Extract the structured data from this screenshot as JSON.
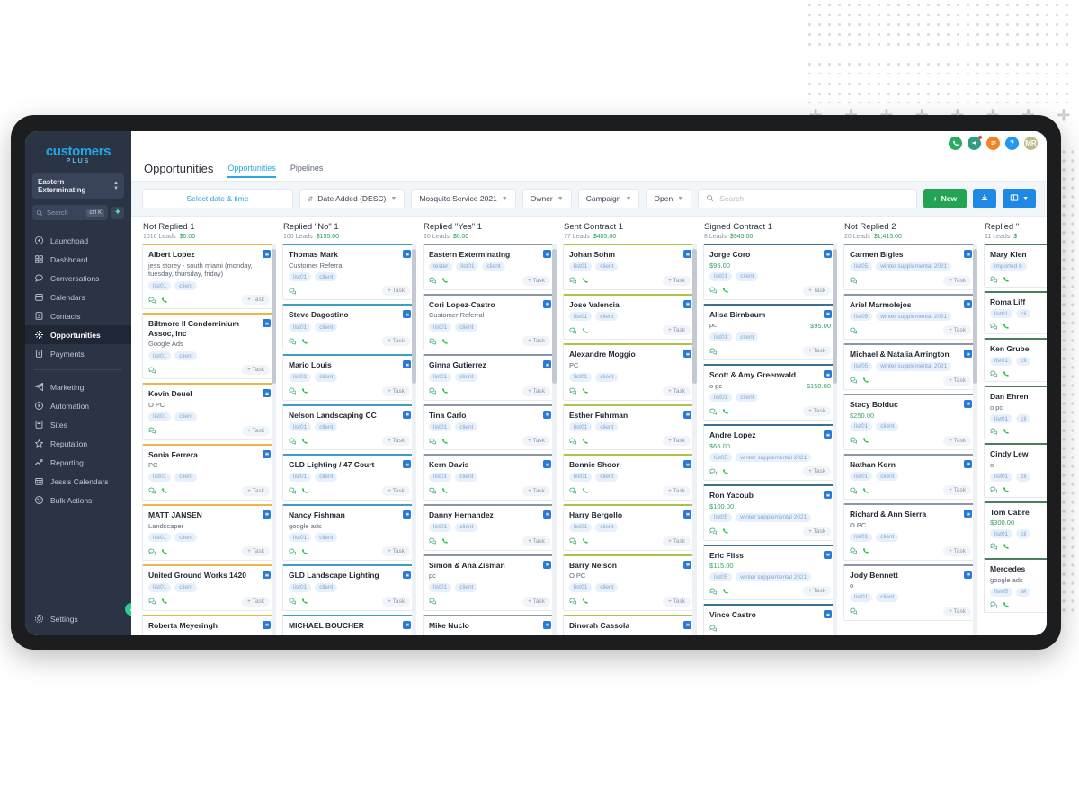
{
  "decor": {
    "plus_glyph": "✛",
    "plus_count": 8
  },
  "brand": {
    "logo_main": "customers",
    "logo_sub": "PLUS"
  },
  "sidebar": {
    "account": "Eastern Exterminating",
    "search_placeholder": "Search",
    "search_kbd": "ctrl K",
    "items": [
      {
        "label": "Launchpad",
        "icon": "rocket-icon",
        "active": false
      },
      {
        "label": "Dashboard",
        "icon": "grid-icon",
        "active": false
      },
      {
        "label": "Conversations",
        "icon": "chat-icon",
        "active": false
      },
      {
        "label": "Calendars",
        "icon": "calendar-icon",
        "active": false
      },
      {
        "label": "Contacts",
        "icon": "contacts-icon",
        "active": false
      },
      {
        "label": "Opportunities",
        "icon": "opportunities-icon",
        "active": true
      },
      {
        "label": "Payments",
        "icon": "payments-icon",
        "active": false
      }
    ],
    "items2": [
      {
        "label": "Marketing",
        "icon": "send-icon"
      },
      {
        "label": "Automation",
        "icon": "play-circle-icon"
      },
      {
        "label": "Sites",
        "icon": "sites-icon"
      },
      {
        "label": "Reputation",
        "icon": "star-icon"
      },
      {
        "label": "Reporting",
        "icon": "trend-icon"
      },
      {
        "label": "Jess's Calendars",
        "icon": "calendar-days-icon"
      },
      {
        "label": "Bulk Actions",
        "icon": "bulk-icon"
      }
    ],
    "settings": {
      "label": "Settings",
      "icon": "gear-icon"
    }
  },
  "topbar": {
    "avatars": [
      {
        "name": "phone-icon-button",
        "color": "#27ae60",
        "glyph": "phone"
      },
      {
        "name": "announcement-icon-button",
        "color": "#2e9e7e",
        "glyph": "megaphone",
        "dot": true
      },
      {
        "name": "menu-icon-button",
        "color": "#f0842b",
        "glyph": "list"
      },
      {
        "name": "help-icon-button",
        "color": "#2196f3",
        "glyph": "?"
      },
      {
        "name": "user-avatar",
        "color": "#bdb98b",
        "glyph": "MR"
      }
    ]
  },
  "page": {
    "title": "Opportunities",
    "tabs": [
      {
        "label": "Opportunities",
        "active": true
      },
      {
        "label": "Pipelines",
        "active": false
      }
    ]
  },
  "filters": {
    "date_label": "Select date & time",
    "sort": {
      "label": "Date Added (DESC)",
      "icon": "sort-icon"
    },
    "pipeline": "Mosquito Service 2021",
    "owner": "Owner",
    "campaign": "Campaign",
    "status": "Open",
    "search_placeholder": "Search",
    "new_button": "New",
    "new_plus": "+",
    "import_icon": "import-icon",
    "view_icon": "board-view-icon",
    "colors": {
      "green": "#23a455",
      "blue": "#1e88e5",
      "accent": "#2aa7e0"
    }
  },
  "board": {
    "columns": [
      {
        "title": "Not Replied 1",
        "leads": "1016 Leads",
        "amount": "$0.00",
        "accent": "#e8b84b",
        "cards": [
          {
            "name": "Albert Lopez",
            "sub": "jess storey - south miami (monday, tuesday, thursday, friday)",
            "tags": [
              "list01",
              "client"
            ],
            "badge": "blue",
            "phone": true,
            "task": "+ Task"
          },
          {
            "name": "Biltmore II Condominium Assoc, Inc",
            "sub": "Google Ads",
            "tags": [
              "list01",
              "client"
            ],
            "badge": "inline",
            "phone": false,
            "task": "+ Task"
          },
          {
            "name": "Kevin Deuel",
            "sub": "O PC",
            "tags": [
              "list01",
              "client"
            ],
            "badge": "red",
            "phone": false,
            "task": "+ Task"
          },
          {
            "name": "Sonia Ferrera",
            "sub": "PC",
            "tags": [
              "list01",
              "client"
            ],
            "badge": "red",
            "phone": true,
            "task": "+ Task"
          },
          {
            "name": "MATT JANSEN",
            "sub": "Landscaper",
            "tags": [
              "list01",
              "client"
            ],
            "badge": "blue",
            "phone": true,
            "task": "+ Task"
          },
          {
            "name": "United Ground Works 1420",
            "sub": "",
            "tags": [
              "list01",
              "client"
            ],
            "badge": "blue",
            "phone": true,
            "task": "+ Task"
          },
          {
            "name": "Roberta Meyeringh",
            "sub": "",
            "tags": [],
            "badge": "blue",
            "phone": false,
            "task": ""
          }
        ]
      },
      {
        "title": "Replied \"No\" 1",
        "leads": "100 Leads",
        "amount": "$155.00",
        "accent": "#3d9fc4",
        "cards": [
          {
            "name": "Thomas Mark",
            "sub": "Customer Referral",
            "tags": [
              "list01",
              "client"
            ],
            "badge": "blue",
            "phone": false,
            "task": "+ Task"
          },
          {
            "name": "Steve Dagostino",
            "sub": "",
            "tags": [
              "list01",
              "client"
            ],
            "badge": "blue",
            "phone": true,
            "task": "+ Task"
          },
          {
            "name": "Mario Louis",
            "sub": "",
            "tags": [
              "list01",
              "client"
            ],
            "badge": "blue",
            "phone": true,
            "task": "+ Task"
          },
          {
            "name": "Nelson Landscaping CC",
            "sub": "",
            "tags": [
              "list01",
              "client"
            ],
            "badge": "blue",
            "phone": true,
            "task": "+ Task"
          },
          {
            "name": "GLD Lighting / 47 Court",
            "sub": "",
            "tags": [
              "list01",
              "client"
            ],
            "badge": "red",
            "phone": true,
            "task": "+ Task"
          },
          {
            "name": "Nancy Fishman",
            "sub": "google ads",
            "tags": [
              "list01",
              "client"
            ],
            "badge": "red",
            "phone": true,
            "task": "+ Task"
          },
          {
            "name": "GLD Landscape Lighting",
            "sub": "",
            "tags": [
              "list01",
              "client"
            ],
            "badge": "blue",
            "phone": true,
            "task": "+ Task"
          },
          {
            "name": "MICHAEL BOUCHER",
            "sub": "",
            "tags": [],
            "badge": "red",
            "phone": false,
            "task": ""
          }
        ]
      },
      {
        "title": "Replied \"Yes\" 1",
        "leads": "20 Leads",
        "amount": "$0.00",
        "accent": "#8a97a8",
        "cards": [
          {
            "name": "Eastern Exterminating",
            "sub": "",
            "tags": [
              "tester",
              "list01",
              "client"
            ],
            "badge": "blue",
            "phone": true,
            "task": "+ Task"
          },
          {
            "name": "Cori Lopez-Castro",
            "sub": "Customer Referral",
            "tags": [
              "list01",
              "client"
            ],
            "badge": "blue",
            "phone": true,
            "task": "+ Task"
          },
          {
            "name": "Ginna Gutierrez",
            "sub": "",
            "tags": [
              "list01",
              "client"
            ],
            "badge": "blue",
            "phone": true,
            "task": "+ Task"
          },
          {
            "name": "Tina Carlo",
            "sub": "",
            "tags": [
              "list01",
              "client"
            ],
            "badge": "red",
            "phone": true,
            "task": "+ Task"
          },
          {
            "name": "Kern Davis",
            "sub": "",
            "tags": [
              "list01",
              "client"
            ],
            "badge": "red",
            "phone": true,
            "task": "+ Task"
          },
          {
            "name": "Danny Hernandez",
            "sub": "",
            "tags": [
              "list01",
              "client"
            ],
            "badge": "red",
            "phone": true,
            "task": "+ Task"
          },
          {
            "name": "Simon & Ana Zisman",
            "sub": "pc",
            "tags": [
              "list01",
              "client"
            ],
            "badge": "red",
            "phone": false,
            "task": "+ Task"
          },
          {
            "name": "Mike Nuclo",
            "sub": "",
            "tags": [],
            "badge": "red",
            "phone": false,
            "task": ""
          }
        ]
      },
      {
        "title": "Sent Contract 1",
        "leads": "77 Leads",
        "amount": "$405.00",
        "accent": "#a9c44a",
        "cards": [
          {
            "name": "Johan Sohm",
            "sub": "",
            "tags": [
              "list01",
              "client"
            ],
            "badge": "blue",
            "phone": true,
            "task": "+ Task"
          },
          {
            "name": "Jose Valencia",
            "sub": "",
            "tags": [
              "list01",
              "client"
            ],
            "badge": "blue",
            "phone": true,
            "task": "+ Task"
          },
          {
            "name": "Alexandre Moggio",
            "sub": "PC",
            "tags": [
              "list01",
              "client"
            ],
            "badge": "red",
            "phone": true,
            "task": "+ Task"
          },
          {
            "name": "Esther Fuhrman",
            "sub": "",
            "tags": [
              "list01",
              "client"
            ],
            "badge": "red",
            "phone": true,
            "task": "+ Task"
          },
          {
            "name": "Bonnie Shoor",
            "sub": "",
            "tags": [
              "list01",
              "client"
            ],
            "badge": "red",
            "phone": true,
            "task": "+ Task"
          },
          {
            "name": "Harry Bergollo",
            "sub": "",
            "tags": [
              "list01",
              "client"
            ],
            "badge": "red",
            "phone": true,
            "task": "+ Task"
          },
          {
            "name": "Barry Nelson",
            "sub": "O PC",
            "tags": [
              "list01",
              "client"
            ],
            "badge": "red",
            "phone": true,
            "task": "+ Task"
          },
          {
            "name": "Dinorah Cassola",
            "sub": "",
            "tags": [],
            "badge": "red",
            "phone": false,
            "task": ""
          }
        ]
      },
      {
        "title": "Signed Contract 1",
        "leads": "8 Leads",
        "amount": "$945.00",
        "accent": "#3f6f8e",
        "cards": [
          {
            "name": "Jorge Coro",
            "sub": "",
            "amount": "$95.00",
            "amount_pos": "below",
            "tags": [
              "list01",
              "client"
            ],
            "badge": "blue",
            "phone": true,
            "task": "+ Task"
          },
          {
            "name": "Alisa Birnbaum",
            "sub": "pc",
            "amount": "$95.00",
            "amount_pos": "right",
            "tags": [
              "list01",
              "client"
            ],
            "badge": "red",
            "phone": false,
            "task": "+ Task"
          },
          {
            "name": "Scott & Amy Greenwald",
            "sub": "o pc",
            "amount": "$150.00",
            "amount_pos": "right",
            "tags": [
              "list01",
              "client"
            ],
            "badge": "red",
            "phone": true,
            "task": "+ Task"
          },
          {
            "name": "Andre Lopez",
            "sub": "",
            "amount": "$65.00",
            "amount_pos": "below",
            "tags": [
              "list05",
              "winter supplemental 2021"
            ],
            "badge": "blue",
            "phone": true,
            "task": "+ Task"
          },
          {
            "name": "Ron Yacoub",
            "sub": "",
            "amount": "$100.00",
            "amount_pos": "below",
            "tags": [
              "list05",
              "winter supplemental 2021"
            ],
            "badge": "blue",
            "phone": true,
            "task": "+ Task"
          },
          {
            "name": "Eric Fliss",
            "sub": "",
            "amount": "$115.00",
            "amount_pos": "below",
            "tags": [
              "list05",
              "winter supplemental 2021"
            ],
            "badge": "blue",
            "phone": true,
            "task": "+ Task"
          },
          {
            "name": "Vince Castro",
            "sub": "",
            "tags": [],
            "badge": "blue",
            "phone": false,
            "task": ""
          }
        ]
      },
      {
        "title": "Not Replied 2",
        "leads": "20 Leads",
        "amount": "$1,415.00",
        "accent": "#8a97a8",
        "cards": [
          {
            "name": "Carmen Bigles",
            "sub": "",
            "tags": [
              "list05",
              "winter supplemental 2021"
            ],
            "badge": "blue",
            "phone": false,
            "task": "+ Task"
          },
          {
            "name": "Ariel Marmolejos",
            "sub": "",
            "tags": [
              "list05",
              "winter supplemental 2021"
            ],
            "badge": "red",
            "phone": false,
            "task": "+ Task"
          },
          {
            "name": "Michael & Natalia Arrington",
            "sub": "",
            "tags": [
              "list05",
              "winter supplemental 2021"
            ],
            "badge": "red",
            "phone": true,
            "task": "+ Task"
          },
          {
            "name": "Stacy Bolduc",
            "sub": "",
            "amount": "$250.00",
            "amount_pos": "below",
            "tags": [
              "list01",
              "client"
            ],
            "badge": "red",
            "phone": true,
            "task": "+ Task"
          },
          {
            "name": "Nathan Korn",
            "sub": "",
            "tags": [
              "list01",
              "client"
            ],
            "badge": "blue",
            "phone": true,
            "task": "+ Task"
          },
          {
            "name": "Richard & Ann Sierra",
            "sub": "O PC",
            "tags": [
              "list01",
              "client"
            ],
            "badge": "blue",
            "phone": true,
            "task": "+ Task"
          },
          {
            "name": "Jody Bennett",
            "sub": "o",
            "tags": [
              "list01",
              "client"
            ],
            "badge": "blue",
            "phone": false,
            "task": "+ Task"
          }
        ]
      },
      {
        "title": "Replied \"",
        "leads": "11 Leads",
        "amount": "$",
        "accent": "#4a7f5e",
        "cards": [
          {
            "name": "Mary Klen",
            "sub": "",
            "tags": [
              "imported b"
            ],
            "badge": "blue",
            "phone": true,
            "task": ""
          },
          {
            "name": "Roma Liff",
            "sub": "",
            "tags": [
              "list01",
              "cli"
            ],
            "badge": "blue",
            "phone": true,
            "task": ""
          },
          {
            "name": "Ken Grube",
            "sub": "",
            "tags": [
              "list01",
              "cli"
            ],
            "badge": "blue",
            "phone": true,
            "task": ""
          },
          {
            "name": "Dan Ehren",
            "sub": "o pc",
            "tags": [
              "list01",
              "cli"
            ],
            "badge": "blue",
            "phone": true,
            "task": ""
          },
          {
            "name": "Cindy Lew",
            "sub": "o",
            "tags": [
              "list01",
              "cli"
            ],
            "badge": "blue",
            "phone": true,
            "task": ""
          },
          {
            "name": "Tom Cabre",
            "sub": "",
            "amount": "$300.00",
            "amount_pos": "below",
            "tags": [
              "list01",
              "cli"
            ],
            "badge": "blue",
            "phone": true,
            "task": ""
          },
          {
            "name": "Mercedes",
            "sub": "google ads",
            "tags": [
              "list05",
              "wi"
            ],
            "badge": "blue",
            "phone": true,
            "task": ""
          }
        ]
      }
    ]
  }
}
